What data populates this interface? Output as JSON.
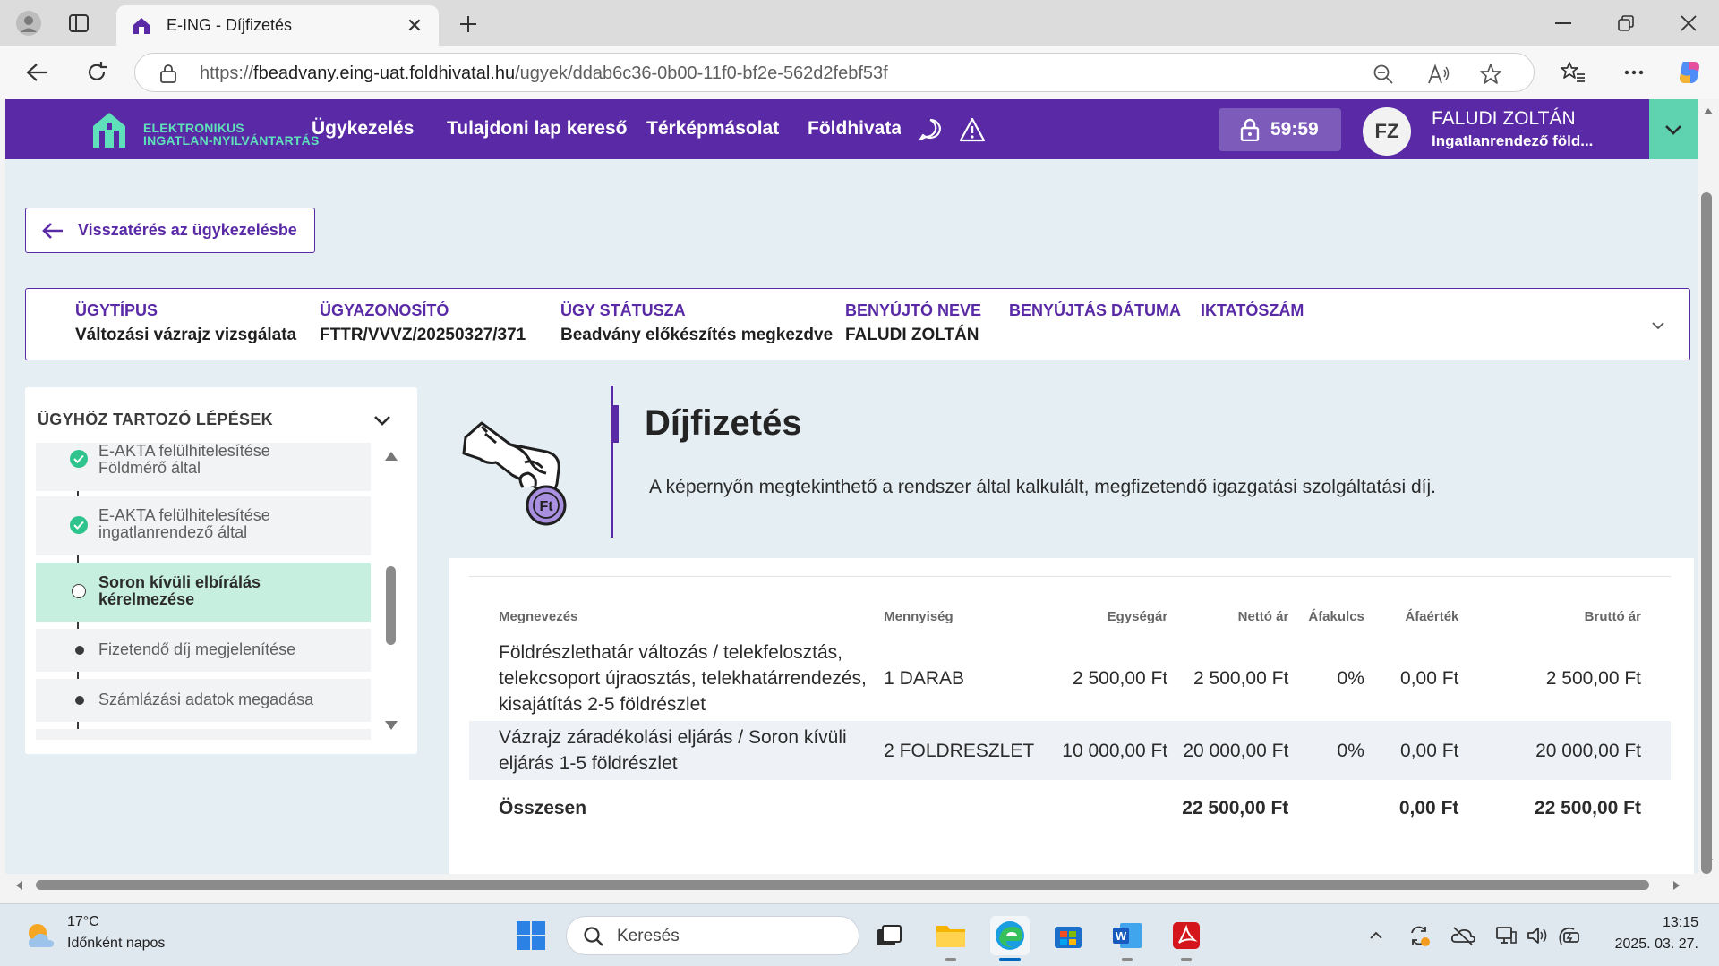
{
  "browser": {
    "tab_title": "E-ING - Díjfizetés",
    "url_prefix": "https://",
    "url_host": "fbeadvany.eing-uat.foldhivatal.hu",
    "url_path": "/ugyek/ddab6c36-0b00-11f0-bf2e-562d2febf53f"
  },
  "app": {
    "logo_line1": "ELEKTRONIKUS",
    "logo_line2": "INGATLAN-NYILVÁNTARTÁS",
    "nav": [
      "Ügykezelés",
      "Tulajdoni lap kereső",
      "Térképmásolat",
      "Földhivatalo"
    ],
    "timer": "59:59",
    "user_initials": "FZ",
    "user_name": "FALUDI ZOLTÁN",
    "user_role": "Ingatlanrendező föld...",
    "accent": "#5a2aa6",
    "accent2": "#5fd3b0"
  },
  "back_button": "Visszatérés az ügykezelésbe",
  "case": [
    {
      "label": "ÜGYTÍPUS",
      "value": "Változási vázrajz vizsgálata"
    },
    {
      "label": "ÜGYAZONOSÍTÓ",
      "value": "FTTR/VVVZ/20250327/371"
    },
    {
      "label": "ÜGY STÁTUSZA",
      "value": "Beadvány előkészítés megkezdve"
    },
    {
      "label": "BENYÚJTÓ NEVE",
      "value": "FALUDI ZOLTÁN"
    },
    {
      "label": "BENYÚJTÁS DÁTUMA",
      "value": ""
    },
    {
      "label": "IKTATÓSZÁM",
      "value": ""
    }
  ],
  "steps": {
    "title": "ÜGYHÖZ TARTOZÓ LÉPÉSEK",
    "items": [
      {
        "line1": "E-AKTA felülhitelesítése",
        "line2": "Földmérő által",
        "state": "done"
      },
      {
        "line1": "E-AKTA felülhitelesítése",
        "line2": "ingatlanrendező által",
        "state": "done"
      },
      {
        "line1": "Soron kívüli elbírálás",
        "line2": "kérelmezése",
        "state": "active"
      },
      {
        "line1": "Fizetendő díj megjelenítése",
        "line2": "",
        "state": "pending"
      },
      {
        "line1": "Számlázási adatok megadása",
        "line2": "",
        "state": "pending"
      }
    ]
  },
  "page": {
    "illustration_label": "Ft",
    "title": "Díjfizetés",
    "description": "A képernyőn megtekinthető a rendszer által kalkulált, megfizetendő igazgatási szolgáltatási díj."
  },
  "fees": {
    "headers": [
      "Megnevezés",
      "Mennyiség",
      "Egységár",
      "Nettó ár",
      "Áfakulcs",
      "Áfaérték",
      "Bruttó ár"
    ],
    "rows": [
      {
        "name_l1": "Földrészlethatár változás / telekfelosztás,",
        "name_l2": "telekcsoport újraosztás, telekhatárrendezés,",
        "name_l3": "kisajátítás 2-5 földrészlet",
        "qty": "1 DARAB",
        "unit": "2 500,00 Ft",
        "net": "2 500,00 Ft",
        "vat_rate": "0%",
        "vat": "0,00 Ft",
        "gross": "2 500,00 Ft"
      },
      {
        "name_l1": "Vázrajz záradékolási eljárás / Soron kívüli",
        "name_l2": "eljárás 1-5 földrészlet",
        "name_l3": "",
        "qty": "2 FOLDRESZLET",
        "unit": "10 000,00 Ft",
        "net": "20 000,00 Ft",
        "vat_rate": "0%",
        "vat": "0,00 Ft",
        "gross": "20 000,00 Ft"
      }
    ],
    "total_label": "Összesen",
    "total_net": "22 500,00 Ft",
    "total_vat": "0,00 Ft",
    "total_gross": "22 500,00 Ft"
  },
  "taskbar": {
    "weather_temp": "17°C",
    "weather_desc": "Időnként napos",
    "search_placeholder": "Keresés",
    "time": "13:15",
    "date": "2025. 03. 27."
  }
}
